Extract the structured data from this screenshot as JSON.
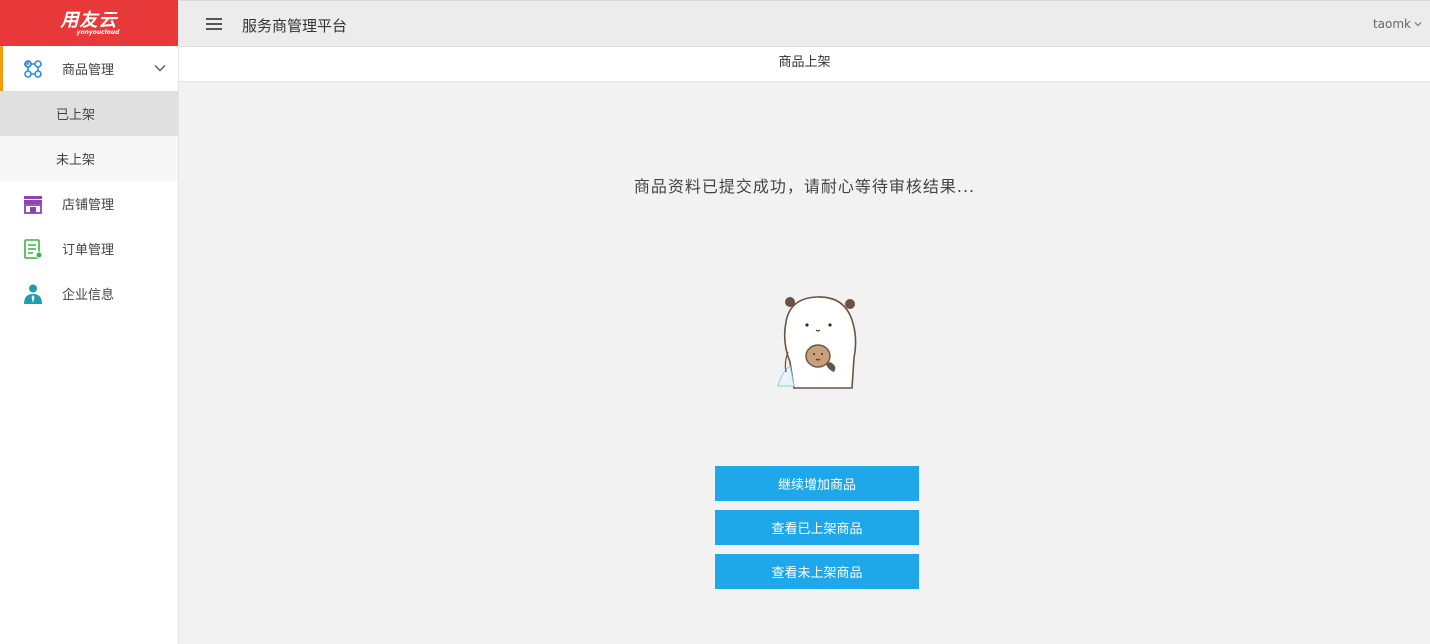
{
  "brand": {
    "logo_text": "用友云",
    "logo_sub": "yonyoucloud",
    "color": "#e8393a"
  },
  "header": {
    "title": "服务商管理平台",
    "user": "taomk"
  },
  "sidebar": {
    "items": [
      {
        "label": "商品管理",
        "icon": "grid-icon",
        "expanded": true,
        "children": [
          {
            "label": "已上架"
          },
          {
            "label": "未上架"
          }
        ]
      },
      {
        "label": "店铺管理",
        "icon": "store-icon"
      },
      {
        "label": "订单管理",
        "icon": "order-list-icon"
      },
      {
        "label": "企业信息",
        "icon": "person-icon"
      }
    ]
  },
  "tabs": [
    {
      "label": "商品上架"
    }
  ],
  "main": {
    "message": "商品资料已提交成功，请耐心等待审核结果...",
    "buttons": {
      "continue_add": "继续增加商品",
      "view_listed": "查看已上架商品",
      "view_unlisted": "查看未上架商品"
    }
  },
  "colors": {
    "accent": "#1ea7e9",
    "active_marker": "#f39c12",
    "header_bg": "#ececec",
    "page_bg": "#f2f2f2"
  }
}
